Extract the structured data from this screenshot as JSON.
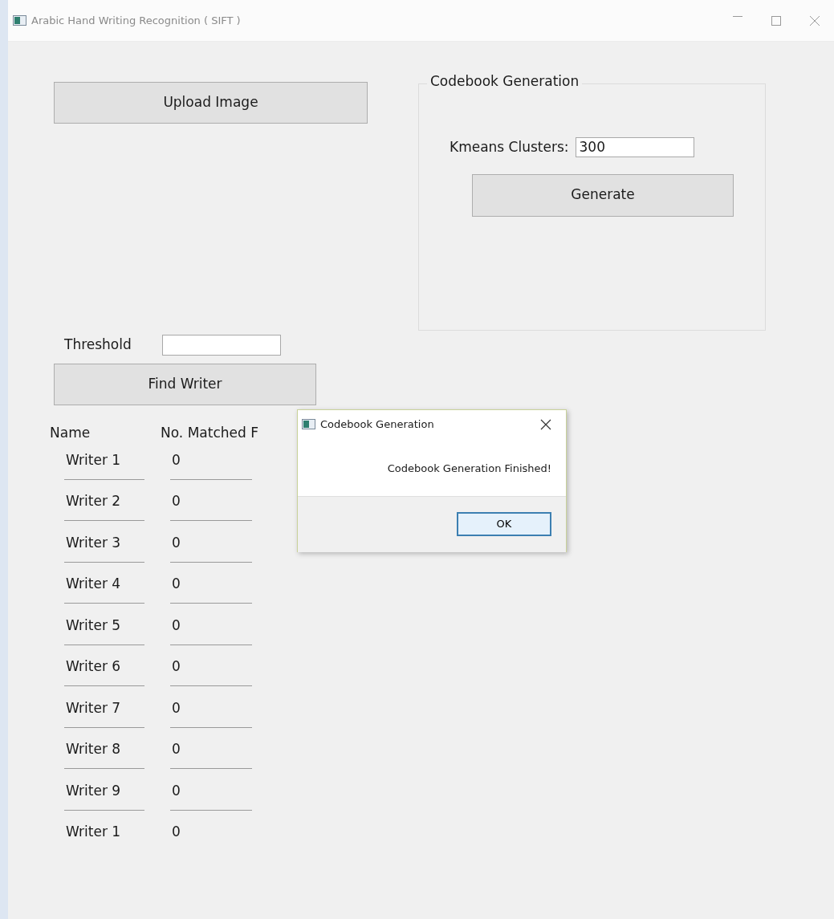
{
  "window": {
    "title": "Arabic Hand Writing Recognition ( SIFT )"
  },
  "upload_button": "Upload Image",
  "codebook": {
    "title": "Codebook Generation",
    "clusters_label": "Kmeans Clusters:",
    "clusters_value": "300",
    "generate_button": "Generate"
  },
  "threshold": {
    "label": "Threshold"
  },
  "find_button": "Find Writer",
  "table": {
    "columns": [
      "Name",
      "No. Matched F"
    ],
    "rows": [
      {
        "name": "Writer 1",
        "matched": "0"
      },
      {
        "name": "Writer 2",
        "matched": "0"
      },
      {
        "name": "Writer 3",
        "matched": "0"
      },
      {
        "name": "Writer 4",
        "matched": "0"
      },
      {
        "name": "Writer 5",
        "matched": "0"
      },
      {
        "name": "Writer 6",
        "matched": "0"
      },
      {
        "name": "Writer 7",
        "matched": "0"
      },
      {
        "name": "Writer 8",
        "matched": "0"
      },
      {
        "name": "Writer 9",
        "matched": "0"
      },
      {
        "name": "Writer 1",
        "matched": "0"
      }
    ]
  },
  "dialog": {
    "title": "Codebook Generation",
    "message": "Codebook Generation Finished!",
    "button": "OK"
  }
}
